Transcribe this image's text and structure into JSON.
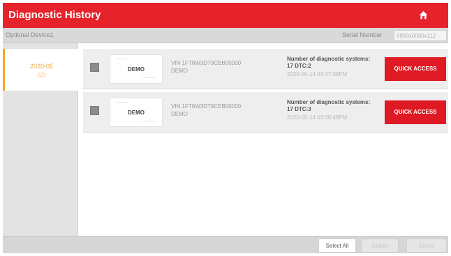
{
  "header": {
    "title": "Diagnostic History",
    "home_icon": "home-icon"
  },
  "subbar": {
    "left_label": "Optional Device1",
    "serial_label": "Serial Number",
    "serial_value": "9890x0000x112"
  },
  "sidebar": {
    "items": [
      {
        "date": "2020-05",
        "count": "(2)"
      }
    ]
  },
  "records": [
    {
      "thumb_top": "———",
      "thumb_label": "DEMO",
      "thumb_bottom": "———",
      "vin": "VIN 1FT8W3DT9CEB00000",
      "model": "DEMO",
      "systems": "Number of diagnostic systems: 17 DTC:2",
      "timestamp": "2020-05-14 03:47:08PM",
      "action": "QUICK ACCESS"
    },
    {
      "thumb_top": "———",
      "thumb_label": "DEMO",
      "thumb_bottom": "———",
      "vin": "VIN 1FT8W3DT9CEB00000",
      "model": "DEMO",
      "systems": "Number of diagnostic systems: 17 DTC:3",
      "timestamp": "2020-05-14 03:36:48PM",
      "action": "QUICK ACCESS"
    }
  ],
  "footer": {
    "select_all": "Select All",
    "btn2": "Delete",
    "btn3": "Delete"
  },
  "colors": {
    "accent": "#e6232a",
    "button": "#e01a24",
    "date": "#f0a030"
  }
}
